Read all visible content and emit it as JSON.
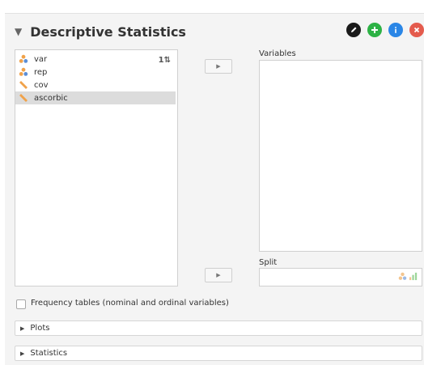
{
  "header": {
    "title": "Descriptive Statistics",
    "collapse_icon": "▼"
  },
  "header_icons": [
    {
      "name": "edit-icon",
      "glyph": "⬤",
      "color": "#1a1a1a"
    },
    {
      "name": "add-icon",
      "glyph": "+",
      "color": "#2db245"
    },
    {
      "name": "info-icon",
      "glyph": "i",
      "color": "#2a86e6"
    },
    {
      "name": "close-icon",
      "glyph": "×",
      "color": "#e45b4d"
    }
  ],
  "variables_list": [
    {
      "label": "var",
      "type": "nominal"
    },
    {
      "label": "rep",
      "type": "nominal"
    },
    {
      "label": "cov",
      "type": "scale"
    },
    {
      "label": "ascorbic",
      "type": "scale",
      "selected": true
    }
  ],
  "sort_icon_text": "1⇅",
  "arrow_glyph": "▶",
  "variables_label": "Variables",
  "split_label": "Split",
  "frequency_label": "Frequency tables (nominal and ordinal variables)",
  "sections": {
    "plots": "Plots",
    "statistics": "Statistics"
  },
  "section_arrow": "▶"
}
